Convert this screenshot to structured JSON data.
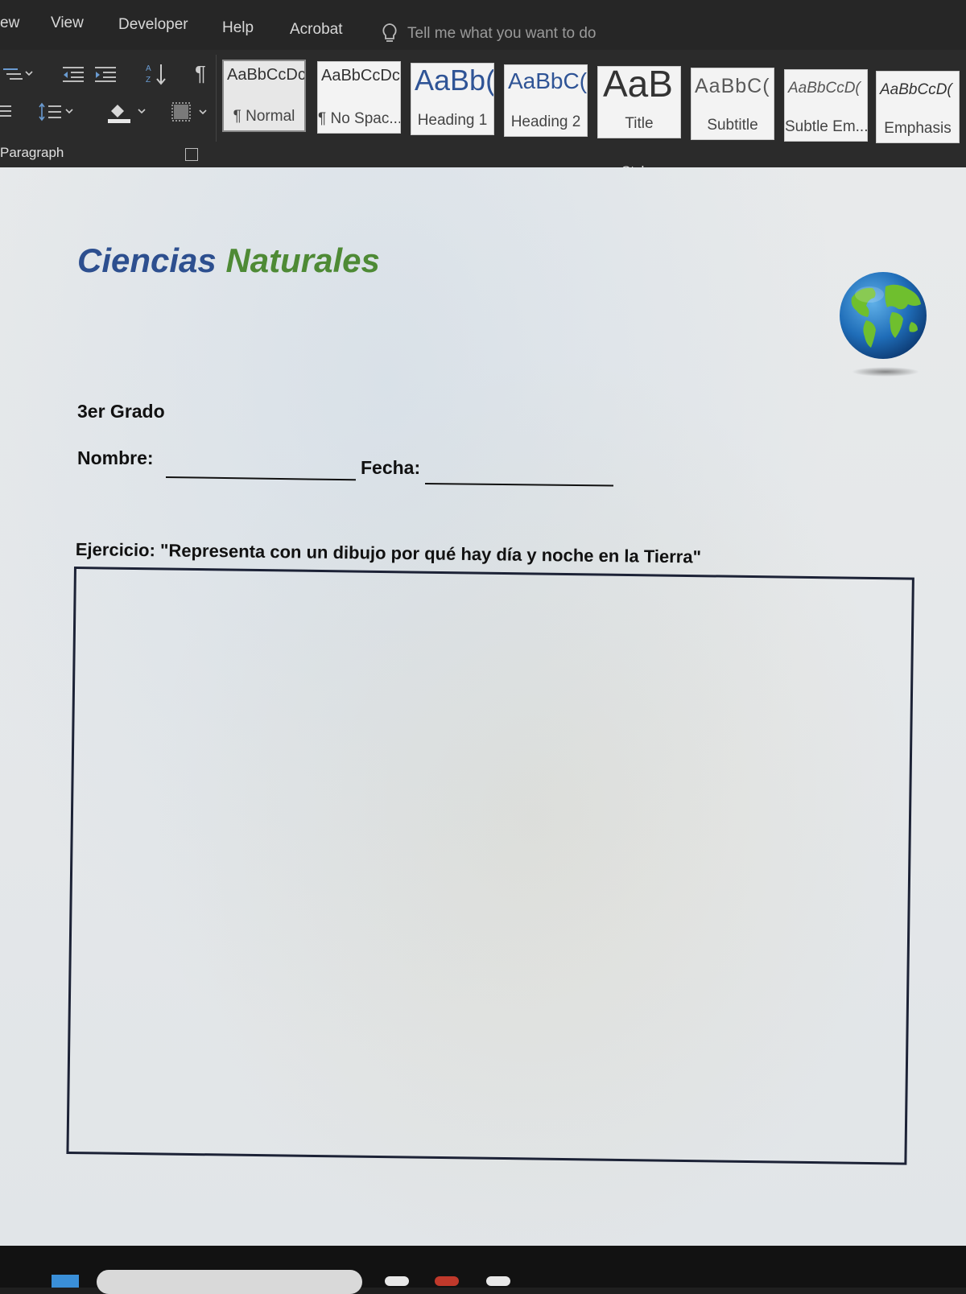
{
  "menu": {
    "items": [
      "ew",
      "View",
      "Developer",
      "Help",
      "Acrobat"
    ],
    "tell_me": "Tell me what you want to do"
  },
  "ribbon": {
    "paragraph_label": "Paragraph",
    "styles_label": "Styles",
    "styles": [
      {
        "sample": "AaBbCcDc",
        "name": "¶ Normal"
      },
      {
        "sample": "AaBbCcDc",
        "name": "¶ No Spac..."
      },
      {
        "sample": "AaBb(",
        "name": "Heading 1"
      },
      {
        "sample": "AaBbC(",
        "name": "Heading 2"
      },
      {
        "sample": "AaB",
        "name": "Title"
      },
      {
        "sample": "AaBbC(",
        "name": "Subtitle"
      },
      {
        "sample": "AaBbCcD(",
        "name": "Subtle Em..."
      },
      {
        "sample": "AaBbCcD(",
        "name": "Emphasis"
      }
    ],
    "colors": {
      "title_blue": "#2d4f8f",
      "title_green": "#4e8a35"
    }
  },
  "document": {
    "title_part1": "Ciencias",
    "title_part2": "Naturales",
    "grade": "3er Grado",
    "name_label": "Nombre:",
    "date_label": "Fecha:",
    "exercise": "Ejercicio: \"Representa con un dibujo por qué hay día y noche en la Tierra\"",
    "globe_icon": "globe-icon"
  }
}
